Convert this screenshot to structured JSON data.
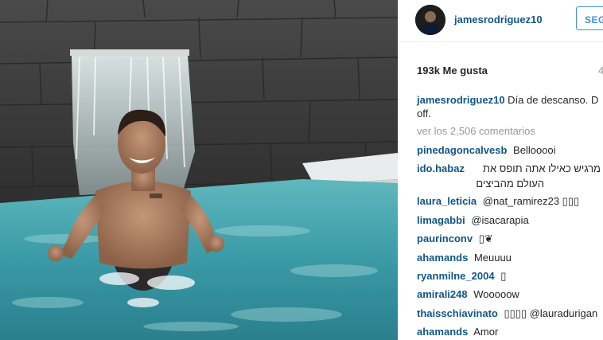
{
  "post": {
    "author": "jamesrodriguez10",
    "follow_label": "SEG",
    "likes": "193k Me gusta",
    "time": "4",
    "caption_text": "Día de descanso. D",
    "caption_text_2": "off.",
    "view_all": "ver los 2,506 comentarios"
  },
  "comments": [
    {
      "user": "pinedagoncalvesb",
      "text": "Bellooooi"
    },
    {
      "user": "ido.habaz",
      "text": "אתה מרגיש כאילו אתה תופס את",
      "text_2": "העולם מהביצים"
    },
    {
      "user": "laura_leticia",
      "text": "@nat_ramirez23 ▯▯▯"
    },
    {
      "user": "limagabbi",
      "text": "@isacarapia"
    },
    {
      "user": "paurinconv",
      "text": "▯❦"
    },
    {
      "user": "ahamands",
      "text": "Meuuuu"
    },
    {
      "user": "ryanmilne_2004",
      "text": "▯"
    },
    {
      "user": "amirali248",
      "text": "Wooooow"
    },
    {
      "user": "thaisschiavinato",
      "text": "▯▯▯▯ @lauradurigan"
    },
    {
      "user": "ahamands",
      "text": "Amor"
    }
  ],
  "colors": {
    "username": "#125688",
    "follow": "#4090db",
    "muted": "#999999"
  }
}
